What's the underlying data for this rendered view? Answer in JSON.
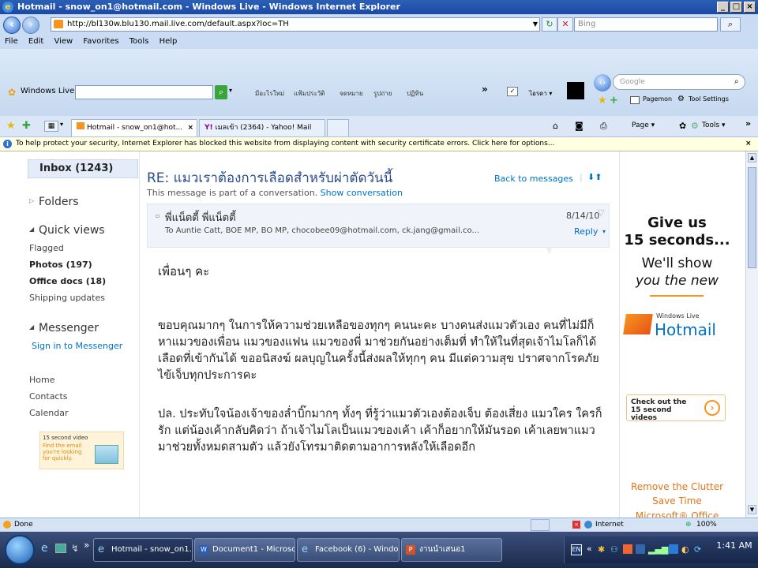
{
  "window": {
    "title": "Hotmail - snow_on1@hotmail.com - Windows Live - Windows Internet Explorer"
  },
  "address": {
    "url": "http://bl130w.blu130.mail.live.com/default.aspx?loc=TH",
    "search_placeholder": "Bing"
  },
  "menu": [
    "File",
    "Edit",
    "View",
    "Favorites",
    "Tools",
    "Help"
  ],
  "windows_live": {
    "brand": "Windows Live",
    "links": [
      "มีอะไรใหม่",
      "แฟ้มประวัติ",
      "จดหมาย",
      "รูปถ่าย",
      "ปฏิทิน"
    ],
    "more": "»",
    "signout": "ไอรดา ▾",
    "google_box": "Google",
    "pagemon": "Pagemon",
    "toolsettings": "Tool Settings"
  },
  "tabs": [
    {
      "label": "Hotmail - snow_on1@hot..."
    },
    {
      "label": "เมลเข้า (2364) - Yahoo! Mail"
    }
  ],
  "command_bar": {
    "page": "Page ▾",
    "tools": "Tools ▾"
  },
  "infobar": {
    "text": "To help protect your security, Internet Explorer has blocked this website from displaying content with security certificate errors. Click here for options..."
  },
  "leftnav": {
    "inbox": "Inbox (1243)",
    "folders": "Folders",
    "quick_views": "Quick views",
    "quick_items": [
      "Flagged",
      "Photos (197)",
      "Office docs (18)",
      "Shipping updates"
    ],
    "messenger": "Messenger",
    "signin": "Sign in to Messenger",
    "links": [
      "Home",
      "Contacts",
      "Calendar"
    ],
    "promo_title": "15 second video",
    "promo_text": "Find the email you're looking for quickly."
  },
  "message": {
    "subject": "RE: แมวเราต้องการเลือดสำหรับผ่าตัดวันนี้",
    "back": "Back to messages",
    "conv_note": "This message is part of a conversation.",
    "show_conv": "Show conversation",
    "sender": "พี่แน็ตตี้ พี่แน็ตตี้",
    "to": "To Auntie Catt, BOE MP, BO MP, chocobee09@hotmail.com, ck.jang@gmail.co...",
    "date": "8/14/10",
    "reply": "Reply",
    "greeting": "เพื่อนๆ คะ",
    "para1": "ขอบคุณมากๆ ในการให้ความช่วยเหลือของทุกๆ คนนะคะ บางคนส่งแมวตัวเอง คนที่ไม่มีก็หาแมวของเพื่อน แมวของแฟน แมวของพี่ มาช่วยกันอย่างเต็มที่ ทำให้ในที่สุดเจ้าไมโลก็ได้เลือดที่เข้ากันได้ ขออนิสงฆ์ ผลบุญในครั้งนี้ส่งผลให้ทุกๆ คน มีแต่ความสุข ปราศจากโรคภัยไข้เจ็บทุกประการคะ",
    "para2": "ปล. ประทับใจน้องเจ้าของล่ำบิ๊กมากๆ ทั้งๆ ที่รู้ว่าแมวตัวเองต้องเจ็บ ต้องเสี่ยง แมวใคร ใครก็รัก แต่น้องเค้ากลับคิดว่า ถ้าเจ้าไมโลเป็นแมวของเค้า เค้าก็อยากให้มันรอด เค้าเลยพาแมวมาช่วยทั้งหมดสามตัว แล้วยังโทรมาติดตามอาการหลังให้เลือดอีก"
  },
  "ad": {
    "line1": "Give us",
    "line2": "15 seconds...",
    "line3": "We'll show",
    "line4": "you the new",
    "wl": "Windows Live",
    "hotmail": "Hotmail",
    "check": "Check out the 15 second videos",
    "clutter1": "Remove the Clutter",
    "clutter2": "Save Time",
    "clutter3": "Microsoft® Office"
  },
  "status": {
    "done": "Done",
    "zone": "Internet",
    "zoom": "100%"
  },
  "taskbar": {
    "items": [
      "Hotmail - snow_on1...",
      "Document1 - Microsoft ...",
      "Facebook (6) - Windows...",
      "งานนำเสนอ1"
    ],
    "clock": "1:41 AM"
  },
  "colors": {
    "accent": "#0072c6",
    "hotmail_orange": "#f7941d",
    "title_blue": "#1c49a3"
  }
}
